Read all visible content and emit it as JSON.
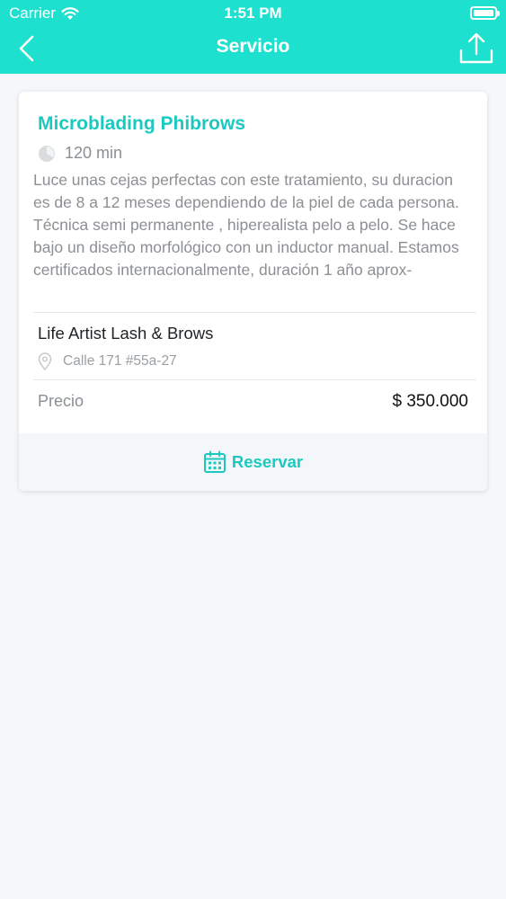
{
  "status_bar": {
    "carrier": "Carrier",
    "time": "1:51 PM"
  },
  "nav": {
    "title": "Servicio",
    "back_icon": "chevron-left-icon",
    "share_icon": "share-icon"
  },
  "service": {
    "name": "Microblading  Phibrows",
    "duration": "120 min",
    "description": "Luce unas cejas perfectas con este tratamiento, su duracion es de 8 a 12 meses dependiendo de la piel de cada persona. Técnica semi permanente , hiperealista pelo a pelo. Se hace bajo un diseño morfológico con un inductor manual. Estamos certificados internacionalmente, duración 1 año aprox-"
  },
  "business": {
    "name": "Life Artist Lash & Brows",
    "address": "Calle 171 #55a-27"
  },
  "price": {
    "label": "Precio",
    "value": "$ 350.000"
  },
  "action": {
    "reserve_label": "Reservar",
    "icon": "calendar-icon"
  },
  "colors": {
    "accent": "#1de0cf",
    "accent_text": "#1cc9c0",
    "background": "#f5f7fa"
  }
}
